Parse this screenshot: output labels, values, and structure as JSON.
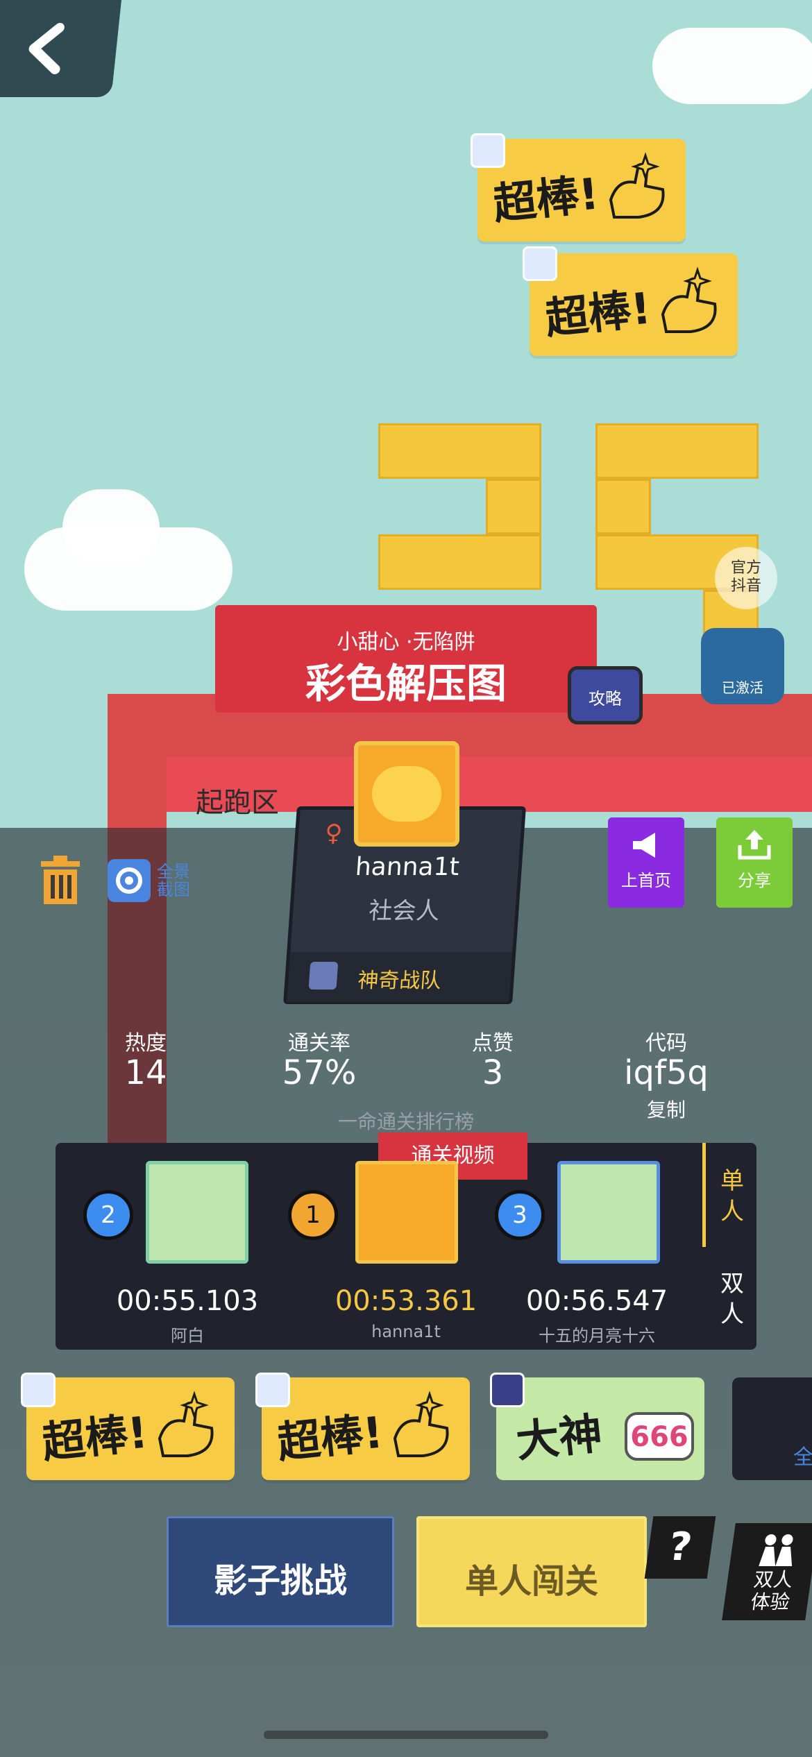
{
  "header": {
    "back_label": ""
  },
  "level": {
    "tags": "小甜心 ·无陷阱",
    "title": "彩色解压图",
    "start_zone": "起跑区",
    "guide_label": "攻略",
    "official_douyin": "官方\n抖音",
    "activated_label": "已激活"
  },
  "player": {
    "name": "hanna1t",
    "role": "社会人",
    "team": "神奇战队",
    "gender_symbol": "♀"
  },
  "tools": {
    "fullscreen_label": "全景\n截图",
    "homepage_label": "上首页",
    "share_label": "分享"
  },
  "stats": [
    {
      "label": "热度",
      "value": "14"
    },
    {
      "label": "通关率",
      "value": "57%"
    },
    {
      "label": "点赞",
      "value": "3"
    },
    {
      "label": "代码",
      "value": "iqf5q"
    }
  ],
  "copy_label": "复制",
  "leaderboard": {
    "title": "一命通关排行榜",
    "video_label": "通关视频",
    "tabs": [
      "单\n人",
      "双\n人"
    ],
    "entries": [
      {
        "rank": "2",
        "time": "00:55.103",
        "name": "阿白"
      },
      {
        "rank": "1",
        "time": "00:53.361",
        "name": "hanna1t"
      },
      {
        "rank": "3",
        "time": "00:56.547",
        "name": "十五的月亮十六"
      }
    ]
  },
  "stickers_top": [
    {
      "text": "超棒!"
    },
    {
      "text": "超棒!"
    }
  ],
  "stickers_bottom": [
    {
      "text": "超棒!"
    },
    {
      "text": "超棒!"
    },
    {
      "text": "大神",
      "number": "666"
    }
  ],
  "bottom_partial": "全",
  "actions": {
    "shadow_challenge": "影子挑战",
    "solo_play": "单人闯关",
    "help": "?",
    "duo_label": "双人\n体验"
  },
  "colors": {
    "sky": "#a9ddd5",
    "banner_red": "#d8343f",
    "lego_yellow": "#f5c73c",
    "gold": "#f4c843",
    "purple": "#8a2be2",
    "green": "#7ccc3a",
    "shadow_blue": "#2f4a7a",
    "solo_yellow": "#f5d75c"
  }
}
